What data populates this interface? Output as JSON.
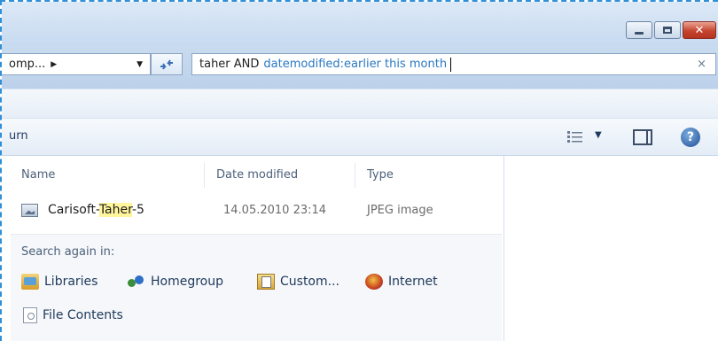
{
  "window": {
    "minimize_glyph": "minimize-icon",
    "maximize_glyph": "maximize-icon",
    "close_label": "✕"
  },
  "address": {
    "breadcrumb_text": "omp...",
    "breadcrumb_arrow": "▶",
    "dropdown_glyph": "▼"
  },
  "search": {
    "query_term": "taher AND",
    "query_keyword": "datemodified:",
    "query_value": "earlier this month",
    "clear_label": "×"
  },
  "commandbar": {
    "label": "urn",
    "view_dropdown": "▼",
    "help_label": "?"
  },
  "columns": {
    "name": "Name",
    "date_modified": "Date modified",
    "type": "Type"
  },
  "files": [
    {
      "name_prefix": "Carisoft-",
      "name_highlight": "Taher",
      "name_suffix": "-5",
      "date": "14.05.2010 23:14",
      "type": "JPEG image"
    }
  ],
  "search_again": {
    "title": "Search again in:",
    "locations": [
      {
        "label": "Libraries",
        "icon": "libraries-icon"
      },
      {
        "label": "Homegroup",
        "icon": "homegroup-icon"
      },
      {
        "label": "Custom...",
        "icon": "custom-folder-icon"
      },
      {
        "label": "Internet",
        "icon": "internet-icon"
      },
      {
        "label": "File Contents",
        "icon": "file-contents-icon"
      }
    ]
  },
  "colors": {
    "accent": "#2a78c2",
    "highlight": "#fff59c",
    "close": "#c7442e"
  }
}
